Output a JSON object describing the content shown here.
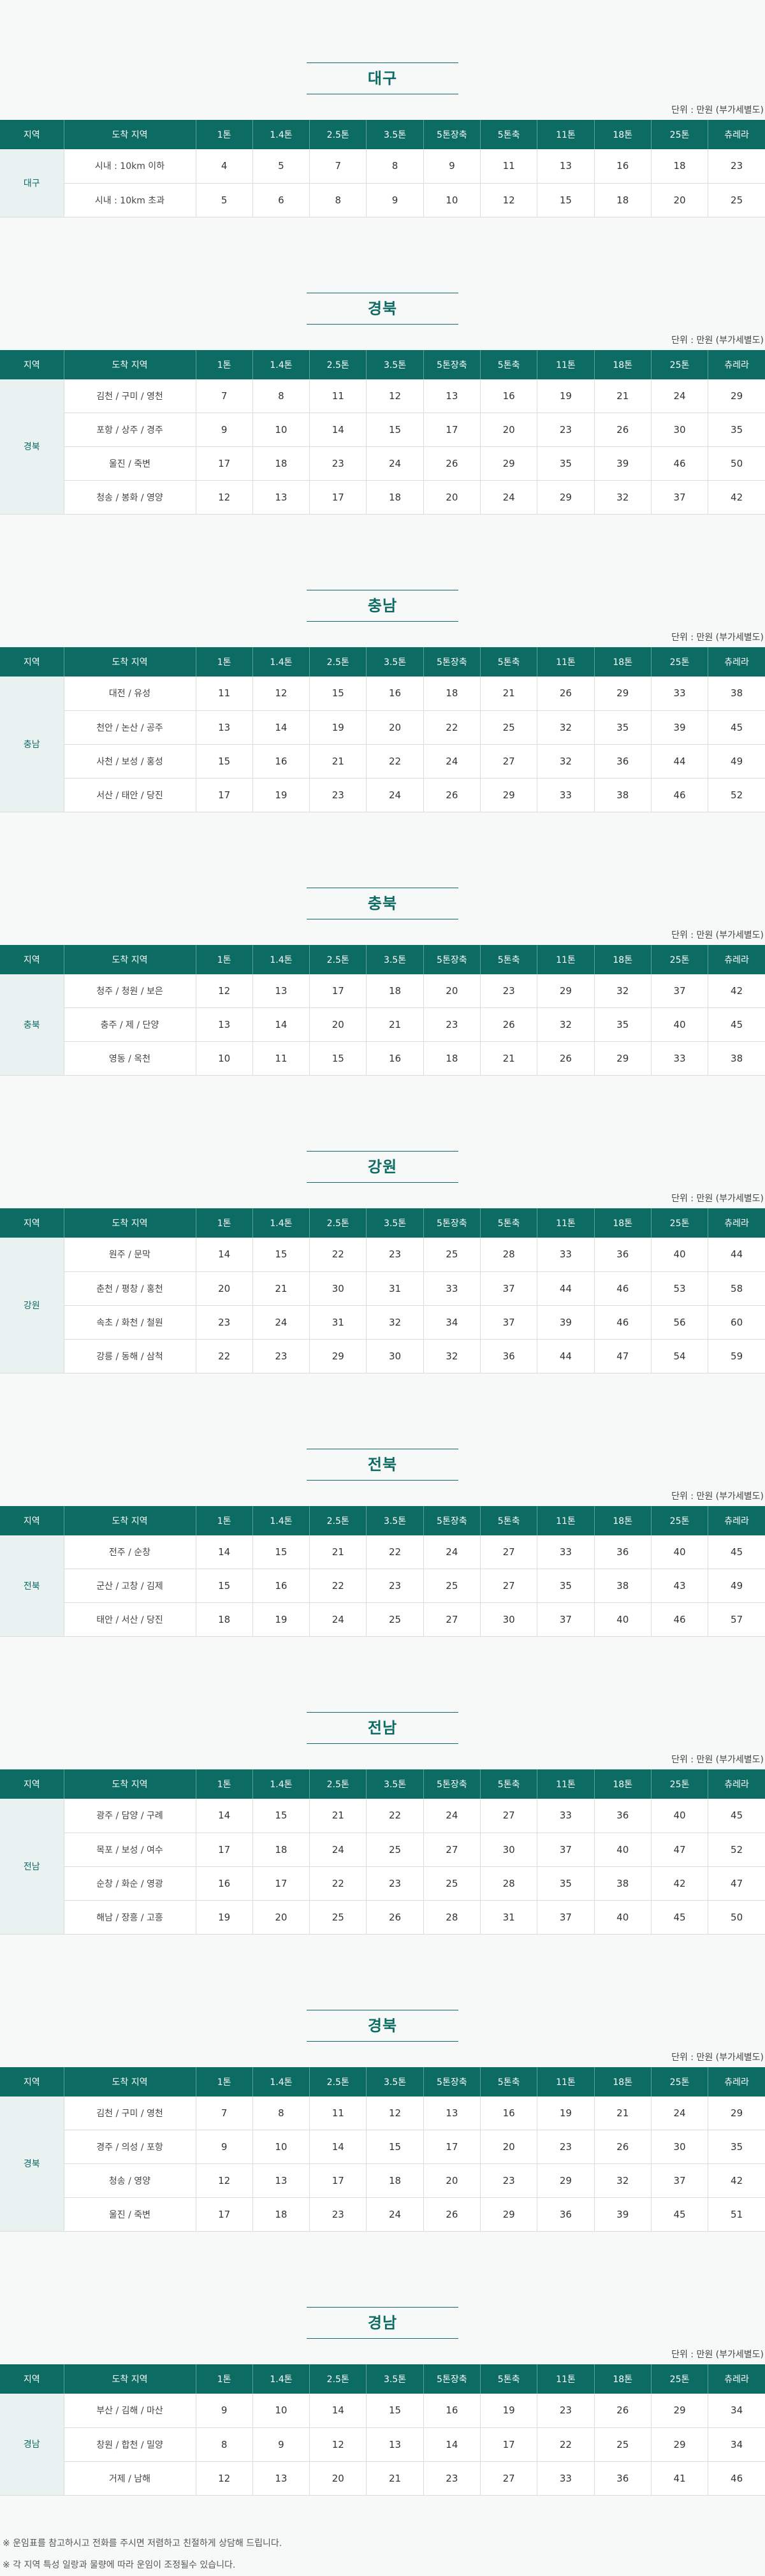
{
  "unit_label": "단위 : 만원 (부가세별도)",
  "columns": [
    "지역",
    "도착 지역",
    "1톤",
    "1.4톤",
    "2.5톤",
    "3.5톤",
    "5톤장축",
    "5톤축",
    "11톤",
    "18톤",
    "25톤",
    "츄레라"
  ],
  "sections": [
    {
      "title": "대구",
      "region": "대구",
      "rows": [
        {
          "dest": "시내 : 10km 이하",
          "values": [
            "4",
            "5",
            "7",
            "8",
            "9",
            "11",
            "13",
            "16",
            "18",
            "23"
          ]
        },
        {
          "dest": "시내 : 10km 초과",
          "values": [
            "5",
            "6",
            "8",
            "9",
            "10",
            "12",
            "15",
            "18",
            "20",
            "25"
          ]
        }
      ]
    },
    {
      "title": "경북",
      "region": "경북",
      "rows": [
        {
          "dest": "김천 / 구미 / 영천",
          "values": [
            "7",
            "8",
            "11",
            "12",
            "13",
            "16",
            "19",
            "21",
            "24",
            "29"
          ]
        },
        {
          "dest": "포항 / 상주 / 경주",
          "values": [
            "9",
            "10",
            "14",
            "15",
            "17",
            "20",
            "23",
            "26",
            "30",
            "35"
          ]
        },
        {
          "dest": "울진 / 죽변",
          "values": [
            "17",
            "18",
            "23",
            "24",
            "26",
            "29",
            "35",
            "39",
            "46",
            "50"
          ]
        },
        {
          "dest": "청송 / 봉화 / 영양",
          "values": [
            "12",
            "13",
            "17",
            "18",
            "20",
            "24",
            "29",
            "32",
            "37",
            "42"
          ]
        }
      ]
    },
    {
      "title": "충남",
      "region": "충남",
      "rows": [
        {
          "dest": "대전 / 유성",
          "values": [
            "11",
            "12",
            "15",
            "16",
            "18",
            "21",
            "26",
            "29",
            "33",
            "38"
          ]
        },
        {
          "dest": "천안 / 논산 / 공주",
          "values": [
            "13",
            "14",
            "19",
            "20",
            "22",
            "25",
            "32",
            "35",
            "39",
            "45"
          ]
        },
        {
          "dest": "사천 / 보성 / 홍성",
          "values": [
            "15",
            "16",
            "21",
            "22",
            "24",
            "27",
            "32",
            "36",
            "44",
            "49"
          ]
        },
        {
          "dest": "서산 / 태안 / 당진",
          "values": [
            "17",
            "19",
            "23",
            "24",
            "26",
            "29",
            "33",
            "38",
            "46",
            "52"
          ]
        }
      ]
    },
    {
      "title": "충북",
      "region": "충북",
      "rows": [
        {
          "dest": "청주 / 청원 / 보은",
          "values": [
            "12",
            "13",
            "17",
            "18",
            "20",
            "23",
            "29",
            "32",
            "37",
            "42"
          ]
        },
        {
          "dest": "충주 / 제 / 단양",
          "values": [
            "13",
            "14",
            "20",
            "21",
            "23",
            "26",
            "32",
            "35",
            "40",
            "45"
          ]
        },
        {
          "dest": "영동 / 옥천",
          "values": [
            "10",
            "11",
            "15",
            "16",
            "18",
            "21",
            "26",
            "29",
            "33",
            "38"
          ]
        }
      ]
    },
    {
      "title": "강원",
      "region": "강원",
      "rows": [
        {
          "dest": "원주 / 문막",
          "values": [
            "14",
            "15",
            "22",
            "23",
            "25",
            "28",
            "33",
            "36",
            "40",
            "44"
          ]
        },
        {
          "dest": "춘천 / 평창 / 홍천",
          "values": [
            "20",
            "21",
            "30",
            "31",
            "33",
            "37",
            "44",
            "46",
            "53",
            "58"
          ]
        },
        {
          "dest": "속초 / 화천 / 철원",
          "values": [
            "23",
            "24",
            "31",
            "32",
            "34",
            "37",
            "39",
            "46",
            "56",
            "60"
          ]
        },
        {
          "dest": "강릉 / 동해 / 삼척",
          "values": [
            "22",
            "23",
            "29",
            "30",
            "32",
            "36",
            "44",
            "47",
            "54",
            "59"
          ]
        }
      ]
    },
    {
      "title": "전북",
      "region": "전북",
      "rows": [
        {
          "dest": "전주 / 순창",
          "values": [
            "14",
            "15",
            "21",
            "22",
            "24",
            "27",
            "33",
            "36",
            "40",
            "45"
          ]
        },
        {
          "dest": "군산 / 고창 / 김제",
          "values": [
            "15",
            "16",
            "22",
            "23",
            "25",
            "27",
            "35",
            "38",
            "43",
            "49"
          ]
        },
        {
          "dest": "태안 / 서산 / 당진",
          "values": [
            "18",
            "19",
            "24",
            "25",
            "27",
            "30",
            "37",
            "40",
            "46",
            "57"
          ]
        }
      ]
    },
    {
      "title": "전남",
      "region": "전남",
      "rows": [
        {
          "dest": "광주 / 담양 / 구례",
          "values": [
            "14",
            "15",
            "21",
            "22",
            "24",
            "27",
            "33",
            "36",
            "40",
            "45"
          ]
        },
        {
          "dest": "목포 / 보성 / 여수",
          "values": [
            "17",
            "18",
            "24",
            "25",
            "27",
            "30",
            "37",
            "40",
            "47",
            "52"
          ]
        },
        {
          "dest": "순창 / 화순 / 영광",
          "values": [
            "16",
            "17",
            "22",
            "23",
            "25",
            "28",
            "35",
            "38",
            "42",
            "47"
          ]
        },
        {
          "dest": "해남 / 장흥 / 고흥",
          "values": [
            "19",
            "20",
            "25",
            "26",
            "28",
            "31",
            "37",
            "40",
            "45",
            "50"
          ]
        }
      ]
    },
    {
      "title": "경북",
      "region": "경북",
      "rows": [
        {
          "dest": "김천 / 구미 / 영천",
          "values": [
            "7",
            "8",
            "11",
            "12",
            "13",
            "16",
            "19",
            "21",
            "24",
            "29"
          ]
        },
        {
          "dest": "경주 / 의성 / 포항",
          "values": [
            "9",
            "10",
            "14",
            "15",
            "17",
            "20",
            "23",
            "26",
            "30",
            "35"
          ]
        },
        {
          "dest": "청송 / 영양",
          "values": [
            "12",
            "13",
            "17",
            "18",
            "20",
            "23",
            "29",
            "32",
            "37",
            "42"
          ]
        },
        {
          "dest": "울진 / 죽변",
          "values": [
            "17",
            "18",
            "23",
            "24",
            "26",
            "29",
            "36",
            "39",
            "45",
            "51"
          ]
        }
      ]
    },
    {
      "title": "경남",
      "region": "경남",
      "rows": [
        {
          "dest": "부산 / 김해 / 마산",
          "values": [
            "9",
            "10",
            "14",
            "15",
            "16",
            "19",
            "23",
            "26",
            "29",
            "34"
          ]
        },
        {
          "dest": "창원 / 합천 / 밀양",
          "values": [
            "8",
            "9",
            "12",
            "13",
            "14",
            "17",
            "22",
            "25",
            "29",
            "34"
          ]
        },
        {
          "dest": "거제 / 남해",
          "values": [
            "12",
            "13",
            "20",
            "21",
            "23",
            "27",
            "33",
            "36",
            "41",
            "46"
          ]
        }
      ]
    }
  ],
  "notes": [
    "※ 운임표를 참고하시고 전화를 주시면 저렴하고 친절하게 상담해 드립니다.",
    "※ 각 지역 특성 일랑과 물량에 따라 운임이 조정될수 있습니다."
  ]
}
